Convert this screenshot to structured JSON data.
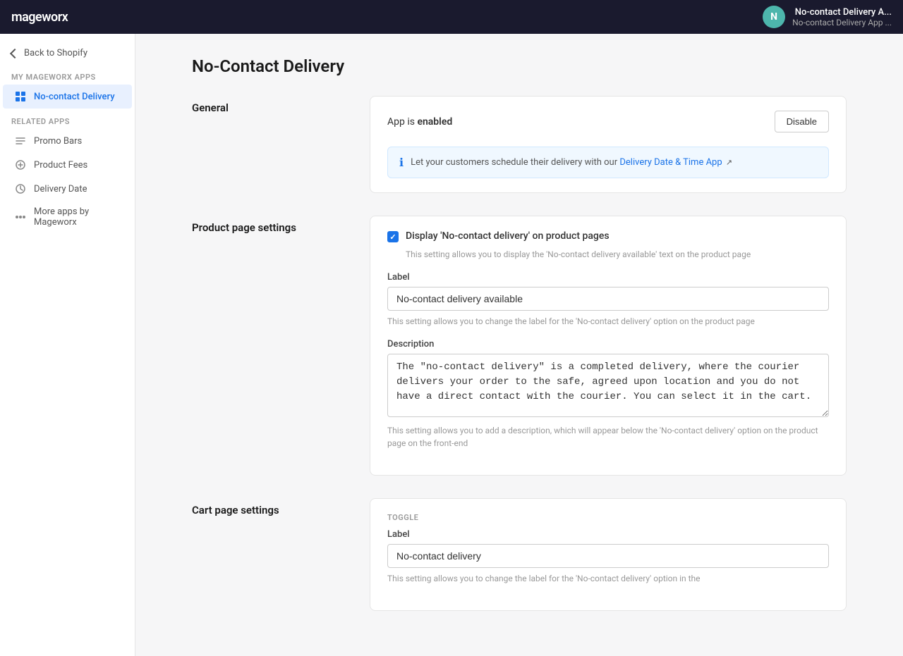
{
  "topbar": {
    "logo": "mageworx",
    "avatar_letter": "N",
    "app_name": "No-contact Delivery A...",
    "app_sub": "No-contact Delivery App ..."
  },
  "sidebar": {
    "back_label": "Back to Shopify",
    "my_apps_section": "MY MAGEWORX APPS",
    "related_apps_section": "RELATED APPS",
    "my_apps": [
      {
        "label": "No-contact Delivery",
        "active": true
      }
    ],
    "related_apps": [
      {
        "label": "Promo Bars"
      },
      {
        "label": "Product Fees"
      },
      {
        "label": "Delivery Date"
      },
      {
        "label": "More apps by Mageworx"
      }
    ]
  },
  "page": {
    "title": "No-Contact Delivery",
    "sections": {
      "general": {
        "label": "General",
        "app_status_text": "App is",
        "app_status_bold": "enabled",
        "disable_btn": "Disable",
        "info_text": "Let your customers schedule their delivery with our",
        "info_link": "Delivery Date & Time App"
      },
      "product_page": {
        "label": "Product page settings",
        "checkbox_label": "Display 'No-contact delivery' on product pages",
        "checkbox_helper": "This setting allows you to display the 'No-contact delivery available' text on the product page",
        "label_field": "Label",
        "label_value": "No-contact delivery available",
        "label_helper": "This setting allows you to change the label for the 'No-contact delivery' option on the product page",
        "description_field": "Description",
        "description_value": "The \"no-contact delivery\" is a completed delivery, where the courier delivers your order to the safe, agreed upon location and you do not have a direct contact with the courier. You can select it in the cart.",
        "description_helper": "This setting allows you to add a description, which will appear below the 'No-contact delivery' option on the product page on the front-end"
      },
      "cart_page": {
        "label": "Cart page settings",
        "toggle_sublabel": "TOGGLE",
        "label_field": "Label",
        "label_value": "No-contact delivery",
        "label_helper": "This setting allows you to change the label for the 'No-contact delivery' option in the"
      }
    }
  }
}
